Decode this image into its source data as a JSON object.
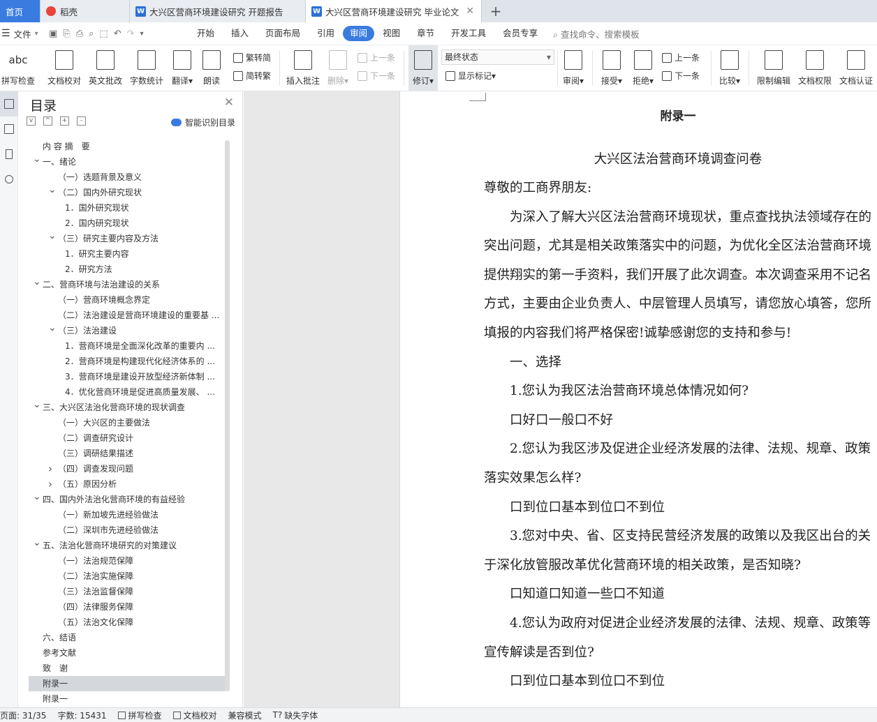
{
  "tabs": {
    "home": "首页",
    "daoke": "稻壳",
    "doc1": "大兴区营商环境建设研究 开题报告",
    "doc2": "大兴区营商环境建设研究 毕业论文",
    "doc_icon": "W"
  },
  "menu": {
    "file": "文件",
    "items": [
      "开始",
      "插入",
      "页面布局",
      "引用",
      "审阅",
      "视图",
      "章节",
      "开发工具",
      "会员专享"
    ],
    "search": "查找命令、搜索模板"
  },
  "ribbon": {
    "spell_icon": "abc",
    "spell": "拼写检查",
    "proof": "文档校对",
    "en_review": "英文批改",
    "word_count": "字数统计",
    "translate": "翻译",
    "read_aloud": "朗读",
    "trad": "繁转简",
    "simp": "简转繁",
    "insert_comment": "插入批注",
    "delete": "删除",
    "prev_comment": "上一条",
    "next_comment": "下一条",
    "revision": "修订",
    "final_state": "最终状态",
    "show_marks": "显示标记",
    "review": "审阅",
    "accept": "接受",
    "reject": "拒绝",
    "prev_change": "上一条",
    "next_change": "下一条",
    "compare": "比较",
    "restrict": "限制编辑",
    "permission": "文档权限",
    "certify": "文档认证"
  },
  "toc": {
    "title": "目录",
    "smart": "智能识别目录",
    "items": [
      {
        "text": "内 容 摘　要",
        "level": 0,
        "arrow": ""
      },
      {
        "text": "一、绪论",
        "level": 0,
        "arrow": "v"
      },
      {
        "text": "（一）选题背景及意义",
        "level": 1,
        "arrow": ""
      },
      {
        "text": "（二）国内外研究现状",
        "level": 1,
        "arrow": "v"
      },
      {
        "text": "1．国外研究现状",
        "level": 2,
        "arrow": ""
      },
      {
        "text": "2．国内研究现状",
        "level": 2,
        "arrow": ""
      },
      {
        "text": "（三）研究主要内容及方法",
        "level": 1,
        "arrow": "v"
      },
      {
        "text": "1．研究主要内容",
        "level": 2,
        "arrow": ""
      },
      {
        "text": "2．研究方法",
        "level": 2,
        "arrow": ""
      },
      {
        "text": "二、营商环境与法治建设的关系",
        "level": 0,
        "arrow": "v"
      },
      {
        "text": "（一）营商环境概念界定",
        "level": 1,
        "arrow": ""
      },
      {
        "text": "（二）法治建设是营商环境建设的重要基 ...",
        "level": 1,
        "arrow": ""
      },
      {
        "text": "（三）法治建设",
        "level": 1,
        "arrow": "v"
      },
      {
        "text": "1．营商环境是全面深化改革的重要内 ...",
        "level": 2,
        "arrow": ""
      },
      {
        "text": "2．营商环境是构建现代化经济体系的 ...",
        "level": 2,
        "arrow": ""
      },
      {
        "text": "3．营商环境是建设开放型经济新体制 ...",
        "level": 2,
        "arrow": ""
      },
      {
        "text": "4．优化营商环境是促进高质量发展、 ...",
        "level": 2,
        "arrow": ""
      },
      {
        "text": "三、大兴区法治化营商环境的现状调查",
        "level": 0,
        "arrow": "v"
      },
      {
        "text": "（一）大兴区的主要做法",
        "level": 1,
        "arrow": ""
      },
      {
        "text": "（二）调查研究设计",
        "level": 1,
        "arrow": ""
      },
      {
        "text": "（三）调研结果描述",
        "level": 1,
        "arrow": ""
      },
      {
        "text": "（四）调查发现问题",
        "level": 1,
        "arrow": ">"
      },
      {
        "text": "（五）原因分析",
        "level": 1,
        "arrow": ">"
      },
      {
        "text": "四、国内外法治化营商环境的有益经验",
        "level": 0,
        "arrow": "v"
      },
      {
        "text": "（一）新加坡先进经验做法",
        "level": 1,
        "arrow": ""
      },
      {
        "text": "（二）深圳市先进经验做法",
        "level": 1,
        "arrow": ""
      },
      {
        "text": "五、法治化营商环境研究的对策建议",
        "level": 0,
        "arrow": "v"
      },
      {
        "text": "（一）法治规范保障",
        "level": 1,
        "arrow": ""
      },
      {
        "text": "（二）法治实施保障",
        "level": 1,
        "arrow": ""
      },
      {
        "text": "（三）法治监督保障",
        "level": 1,
        "arrow": ""
      },
      {
        "text": "（四）法律服务保障",
        "level": 1,
        "arrow": ""
      },
      {
        "text": "（五）法治文化保障",
        "level": 1,
        "arrow": ""
      },
      {
        "text": "六、结语",
        "level": 0,
        "arrow": ""
      },
      {
        "text": "参考文献",
        "level": 0,
        "arrow": ""
      },
      {
        "text": "致　谢",
        "level": 0,
        "arrow": ""
      },
      {
        "text": "附录一",
        "level": 0,
        "arrow": "",
        "selected": true
      },
      {
        "text": "附录一",
        "level": 0,
        "arrow": ""
      }
    ]
  },
  "doc": {
    "heading": "附录一",
    "title": "大兴区法治营商环境调查问卷",
    "lines": [
      {
        "text": "尊敬的工商界朋友:",
        "indent": 0
      },
      {
        "text": "为深入了解大兴区法治营商环境现状，重点查找执法领域存在的",
        "indent": 1
      },
      {
        "text": "突出问题，尤其是相关政策落实中的问题，为优化全区法治营商环境",
        "indent": 0
      },
      {
        "text": "提供翔实的第一手资料，我们开展了此次调查。本次调查采用不记名",
        "indent": 0
      },
      {
        "text": "方式，主要由企业负责人、中层管理人员填写，请您放心填答，您所",
        "indent": 0
      },
      {
        "text": "填报的内容我们将严格保密!诚挚感谢您的支持和参与!",
        "indent": 0
      },
      {
        "text": "一、选择",
        "indent": 1
      },
      {
        "text": "1.您认为我区法治营商环境总体情况如何?",
        "indent": 1
      },
      {
        "text": "口好口一般口不好",
        "indent": 1
      },
      {
        "text": "2.您认为我区涉及促进企业经济发展的法律、法规、规章、政策",
        "indent": 1
      },
      {
        "text": "落实效果怎么样?",
        "indent": 0
      },
      {
        "text": "口到位口基本到位口不到位",
        "indent": 1
      },
      {
        "text": "3.您对中央、省、区支持民营经济发展的政策以及我区出台的关",
        "indent": 1
      },
      {
        "text": "于深化放管服改革优化营商环境的相关政策，是否知晓?",
        "indent": 0
      },
      {
        "text": "口知道口知道一些口不知道",
        "indent": 1
      },
      {
        "text": "4.您认为政府对促进企业经济发展的法律、法规、规章、政策等",
        "indent": 1
      },
      {
        "text": "宣传解读是否到位?",
        "indent": 0
      },
      {
        "text": "口到位口基本到位口不到位",
        "indent": 1
      }
    ]
  },
  "statusbar": {
    "page": "页面: 31/35",
    "words": "字数: 15431",
    "spell": "拼写检查",
    "proof": "文档校对",
    "compat": "兼容模式",
    "missing_font": "缺失字体"
  },
  "colors": {
    "accent": "#3a7be0",
    "tabbar": "#dfe3ea",
    "selected_row": "#d4d7dc",
    "canvas": "#e8e8e8"
  }
}
